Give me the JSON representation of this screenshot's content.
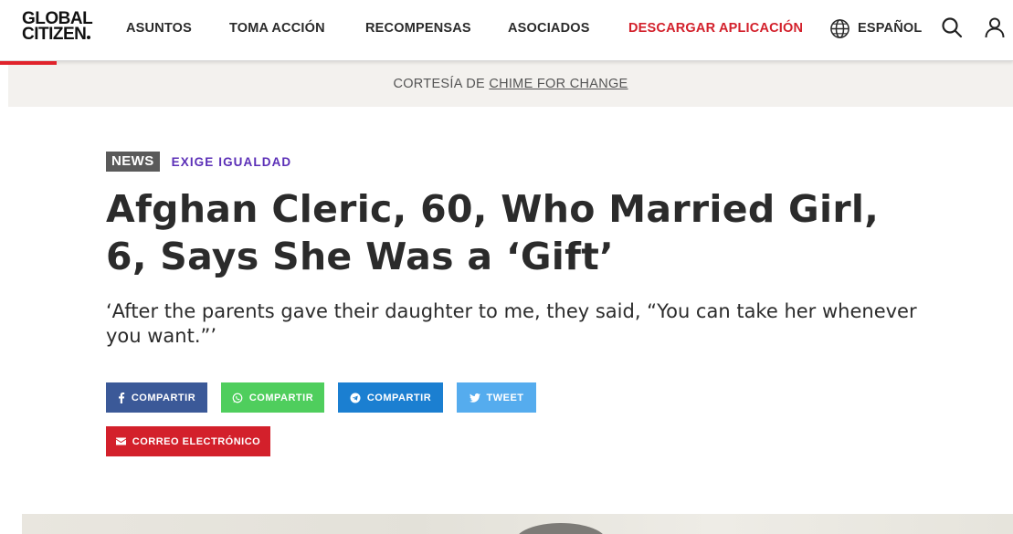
{
  "header": {
    "logo_line1": "GLOBAL",
    "logo_line2": "CITIZEN",
    "nav": [
      {
        "label": "ASUNTOS"
      },
      {
        "label": "TOMA ACCIÓN"
      },
      {
        "label": "RECOMPENSAS"
      },
      {
        "label": "ASOCIADOS"
      },
      {
        "label": "DESCARGAR APLICACIÓN"
      }
    ],
    "language_label": "ESPAÑOL",
    "icons": [
      "globe-icon",
      "search-icon",
      "user-icon"
    ],
    "accent_color": "#e0232b",
    "highlight_color": "#d3202b"
  },
  "courtesy": {
    "prefix": "CORTESÍA DE",
    "link": "CHIME FOR CHANGE"
  },
  "article": {
    "badge": "NEWS",
    "category": "EXIGE IGUALDAD",
    "category_color": "#5b2fb7",
    "title": "Afghan Cleric, 60, Who Married Girl, 6, Says She Was a ‘Gift’",
    "subtitle": "‘After the parents gave their daughter to me, they said, “You can take her whenever you want.”’"
  },
  "share": {
    "facebook": {
      "label": "COMPARTIR",
      "icon": "facebook-icon",
      "color": "#3b5998"
    },
    "whatsapp": {
      "label": "COMPARTIR",
      "icon": "whatsapp-icon",
      "color": "#4fce5d"
    },
    "telegram": {
      "label": "COMPARTIR",
      "icon": "telegram-icon",
      "color": "#1b7fd1"
    },
    "twitter": {
      "label": "TWEET",
      "icon": "twitter-icon",
      "color": "#55acee"
    },
    "email": {
      "label": "CORREO ELECTRÓNICO",
      "icon": "envelope-icon",
      "color": "#d3202b"
    }
  }
}
